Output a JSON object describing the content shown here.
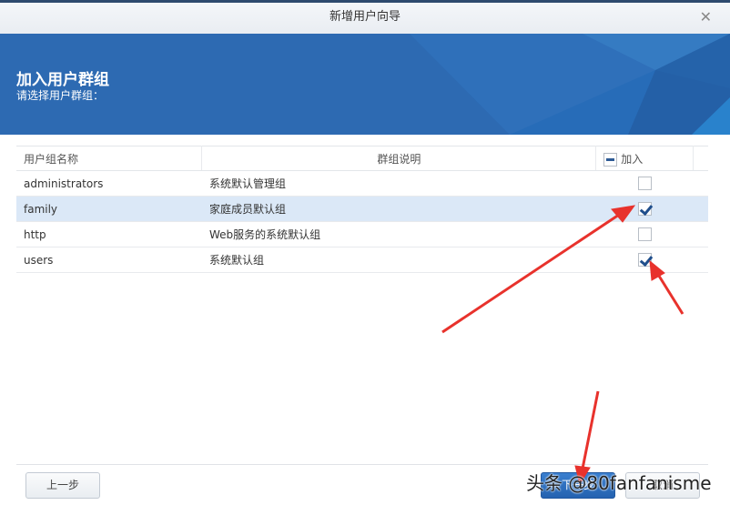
{
  "window": {
    "title": "新增用户向导"
  },
  "banner": {
    "title": "加入用户群组",
    "subtitle": "请选择用户群组："
  },
  "table": {
    "headers": [
      "用户组名称",
      "群组说明",
      "加入"
    ],
    "rows": [
      {
        "name": "administrators",
        "desc": "系统默认管理组",
        "checked": false
      },
      {
        "name": "family",
        "desc": "家庭成员默认组",
        "checked": true
      },
      {
        "name": "http",
        "desc": "Web服务的系统默认组",
        "checked": false
      },
      {
        "name": "users",
        "desc": "系统默认组",
        "checked": true
      }
    ]
  },
  "footer": {
    "back": "上一步",
    "next": "下一步",
    "cancel": "取消"
  },
  "watermark": "头条 @80fanfanisme",
  "colors": {
    "banner": "#2d6ab2",
    "primary": "#2462b0",
    "annotation": "#e8322c"
  }
}
